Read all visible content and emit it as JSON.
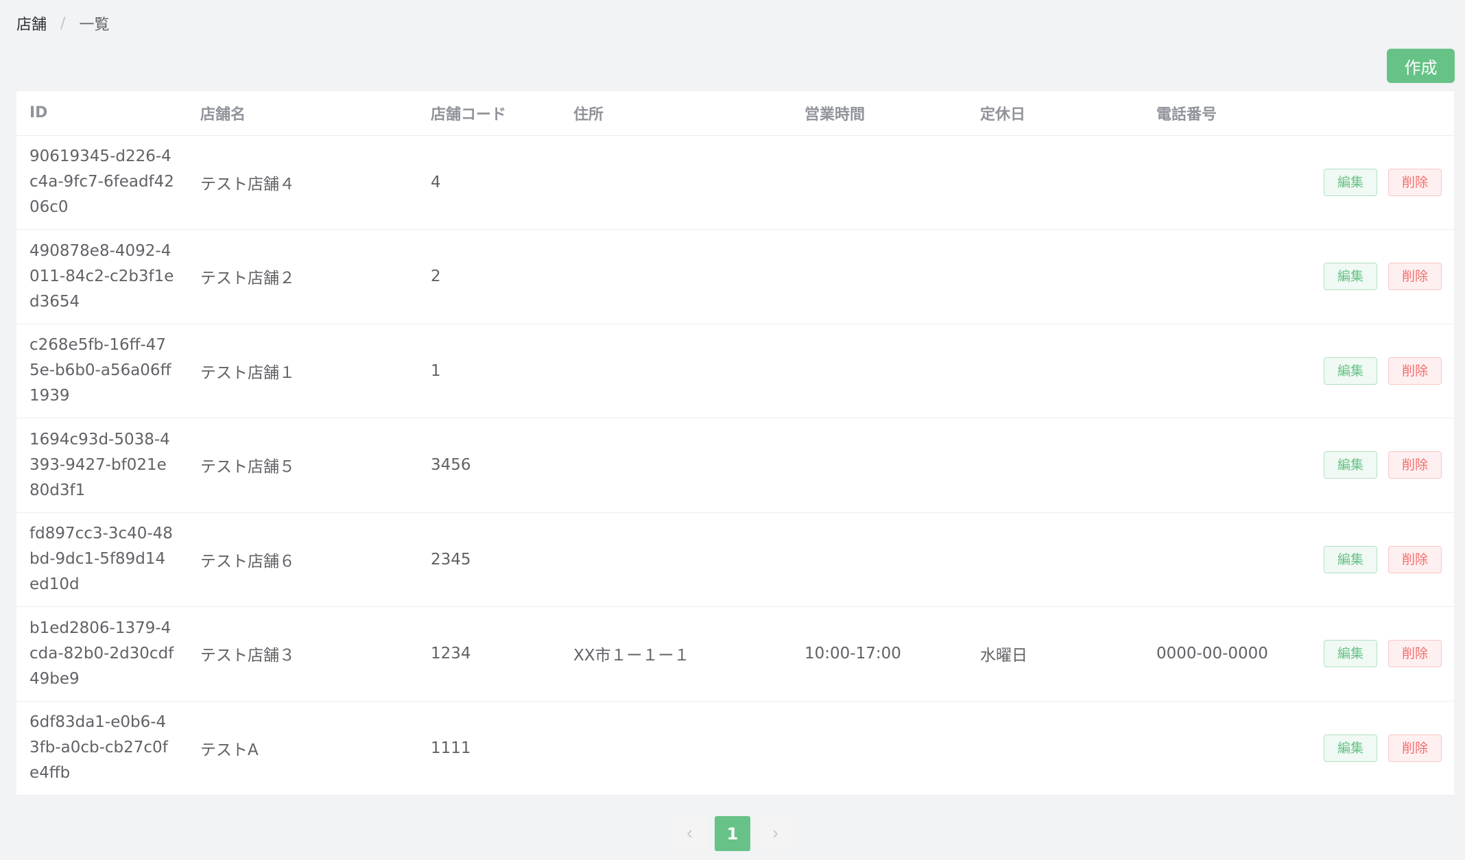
{
  "breadcrumb": {
    "parent": "店舗",
    "separator": "/",
    "current": "一覧"
  },
  "toolbar": {
    "create_label": "作成"
  },
  "table": {
    "headers": {
      "id": "ID",
      "name": "店舗名",
      "code": "店舗コード",
      "address": "住所",
      "hours": "営業時間",
      "holiday": "定休日",
      "phone": "電話番号"
    },
    "rows": [
      {
        "id": "90619345-d226-4c4a-9fc7-6feadf4206c0",
        "name": "テスト店舗４",
        "code": "4",
        "address": "",
        "hours": "",
        "holiday": "",
        "phone": ""
      },
      {
        "id": "490878e8-4092-4011-84c2-c2b3f1ed3654",
        "name": "テスト店舗２",
        "code": "2",
        "address": "",
        "hours": "",
        "holiday": "",
        "phone": ""
      },
      {
        "id": "c268e5fb-16ff-475e-b6b0-a56a06ff1939",
        "name": "テスト店舗１",
        "code": "1",
        "address": "",
        "hours": "",
        "holiday": "",
        "phone": ""
      },
      {
        "id": "1694c93d-5038-4393-9427-bf021e80d3f1",
        "name": "テスト店舗５",
        "code": "3456",
        "address": "",
        "hours": "",
        "holiday": "",
        "phone": ""
      },
      {
        "id": "fd897cc3-3c40-48bd-9dc1-5f89d14ed10d",
        "name": "テスト店舗６",
        "code": "2345",
        "address": "",
        "hours": "",
        "holiday": "",
        "phone": ""
      },
      {
        "id": "b1ed2806-1379-4cda-82b0-2d30cdf49be9",
        "name": "テスト店舗３",
        "code": "1234",
        "address": "XX市１ー１ー１",
        "hours": "10:00-17:00",
        "holiday": "水曜日",
        "phone": "0000-00-0000"
      },
      {
        "id": "6df83da1-e0b6-43fb-a0cb-cb27c0fe4ffb",
        "name": "テストA",
        "code": "1111",
        "address": "",
        "hours": "",
        "holiday": "",
        "phone": ""
      }
    ],
    "actions": {
      "edit_label": "編集",
      "delete_label": "削除"
    }
  },
  "pagination": {
    "current_page": "1",
    "prev_icon": "chevron-left-icon",
    "next_icon": "chevron-right-icon"
  },
  "colors": {
    "primary": "#67c287",
    "danger": "#f56c6c",
    "background": "#f2f3f5"
  }
}
